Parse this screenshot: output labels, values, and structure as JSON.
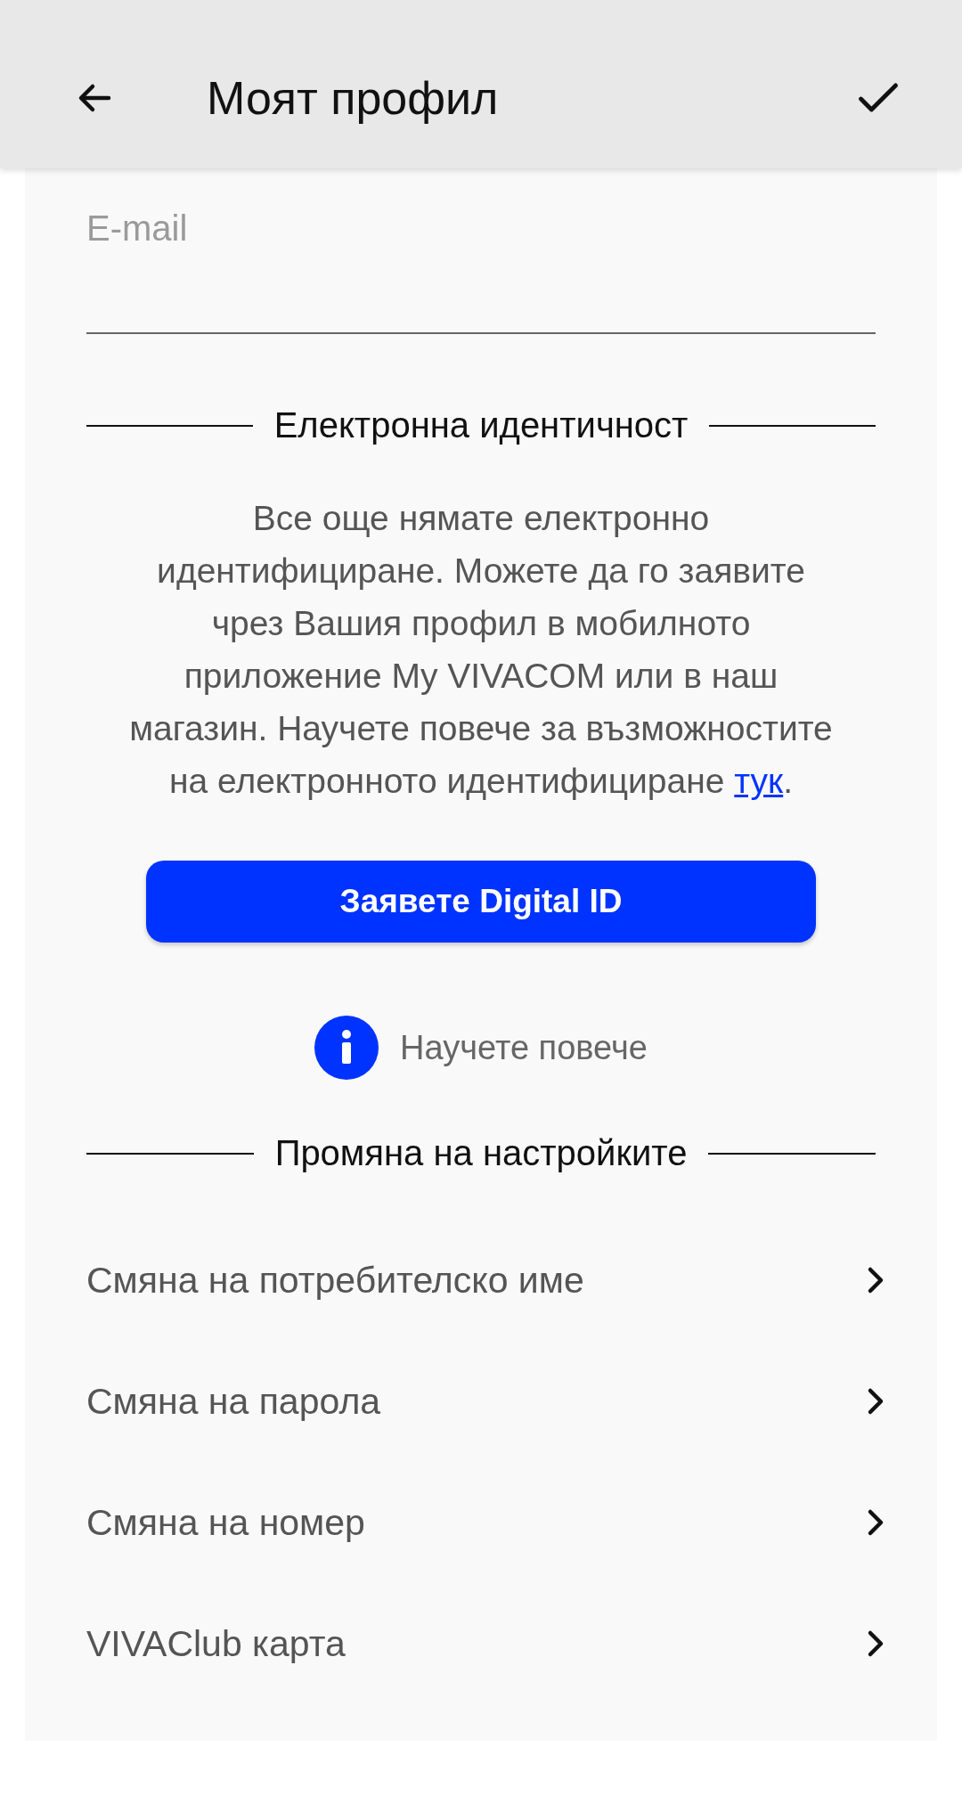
{
  "header": {
    "title": "Моят профил"
  },
  "email": {
    "placeholder": "E-mail"
  },
  "identity": {
    "title": "Електронна идентичност",
    "text": "Все още нямате електронно идентифициране. Можете да го заявите чрез Вашия профил в мобилното приложение My VIVACOM или в наш магазин. Научете повече за възможностите на електронното идентифициране ",
    "link": "тук",
    "after": ".",
    "button": "Заявете Digital ID",
    "info": "Научете повече"
  },
  "settings": {
    "title": "Промяна на настройките",
    "items": [
      {
        "label": "Смяна на потребителско име"
      },
      {
        "label": "Смяна на парола"
      },
      {
        "label": "Смяна на номер"
      },
      {
        "label": "VIVAClub карта"
      }
    ]
  }
}
